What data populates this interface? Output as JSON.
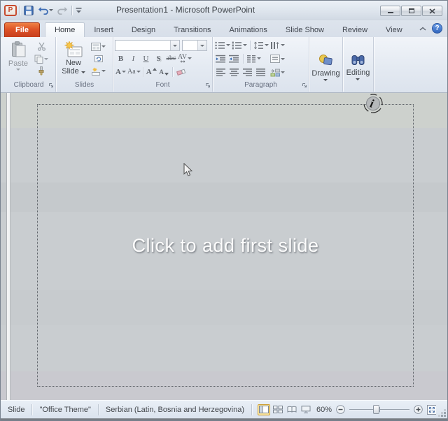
{
  "titlebar": {
    "title": "Presentation1 - Microsoft PowerPoint"
  },
  "qat": {
    "app_glyph": "P"
  },
  "tabs": {
    "file": "File",
    "home": "Home",
    "insert": "Insert",
    "design": "Design",
    "transitions": "Transitions",
    "animations": "Animations",
    "slide_show": "Slide Show",
    "review": "Review",
    "view": "View",
    "help": "?"
  },
  "ribbon": {
    "clipboard": {
      "label": "Clipboard",
      "paste": "Paste"
    },
    "slides": {
      "label": "Slides",
      "new_slide": "New Slide"
    },
    "font": {
      "label": "Font",
      "bold": "B",
      "italic": "I",
      "underline": "U",
      "shadow": "S",
      "strikethrough": "abc",
      "char_spacing": "AV",
      "font_color": "A",
      "change_case": "Aa",
      "grow_font": "A",
      "shrink_font": "A"
    },
    "paragraph": {
      "label": "Paragraph"
    },
    "drawing": {
      "label": "Drawing"
    },
    "editing": {
      "label": "Editing"
    }
  },
  "canvas": {
    "placeholder": "Click to add first slide"
  },
  "statusbar": {
    "slide": "Slide",
    "theme": "\"Office Theme\"",
    "language": "Serbian (Latin, Bosnia and Herzegovina)",
    "zoom": "60%"
  },
  "colors": {
    "file_tab": "#d9501f",
    "active_view_highlight": "#fbe7a3",
    "help_button": "#3d74cf"
  }
}
